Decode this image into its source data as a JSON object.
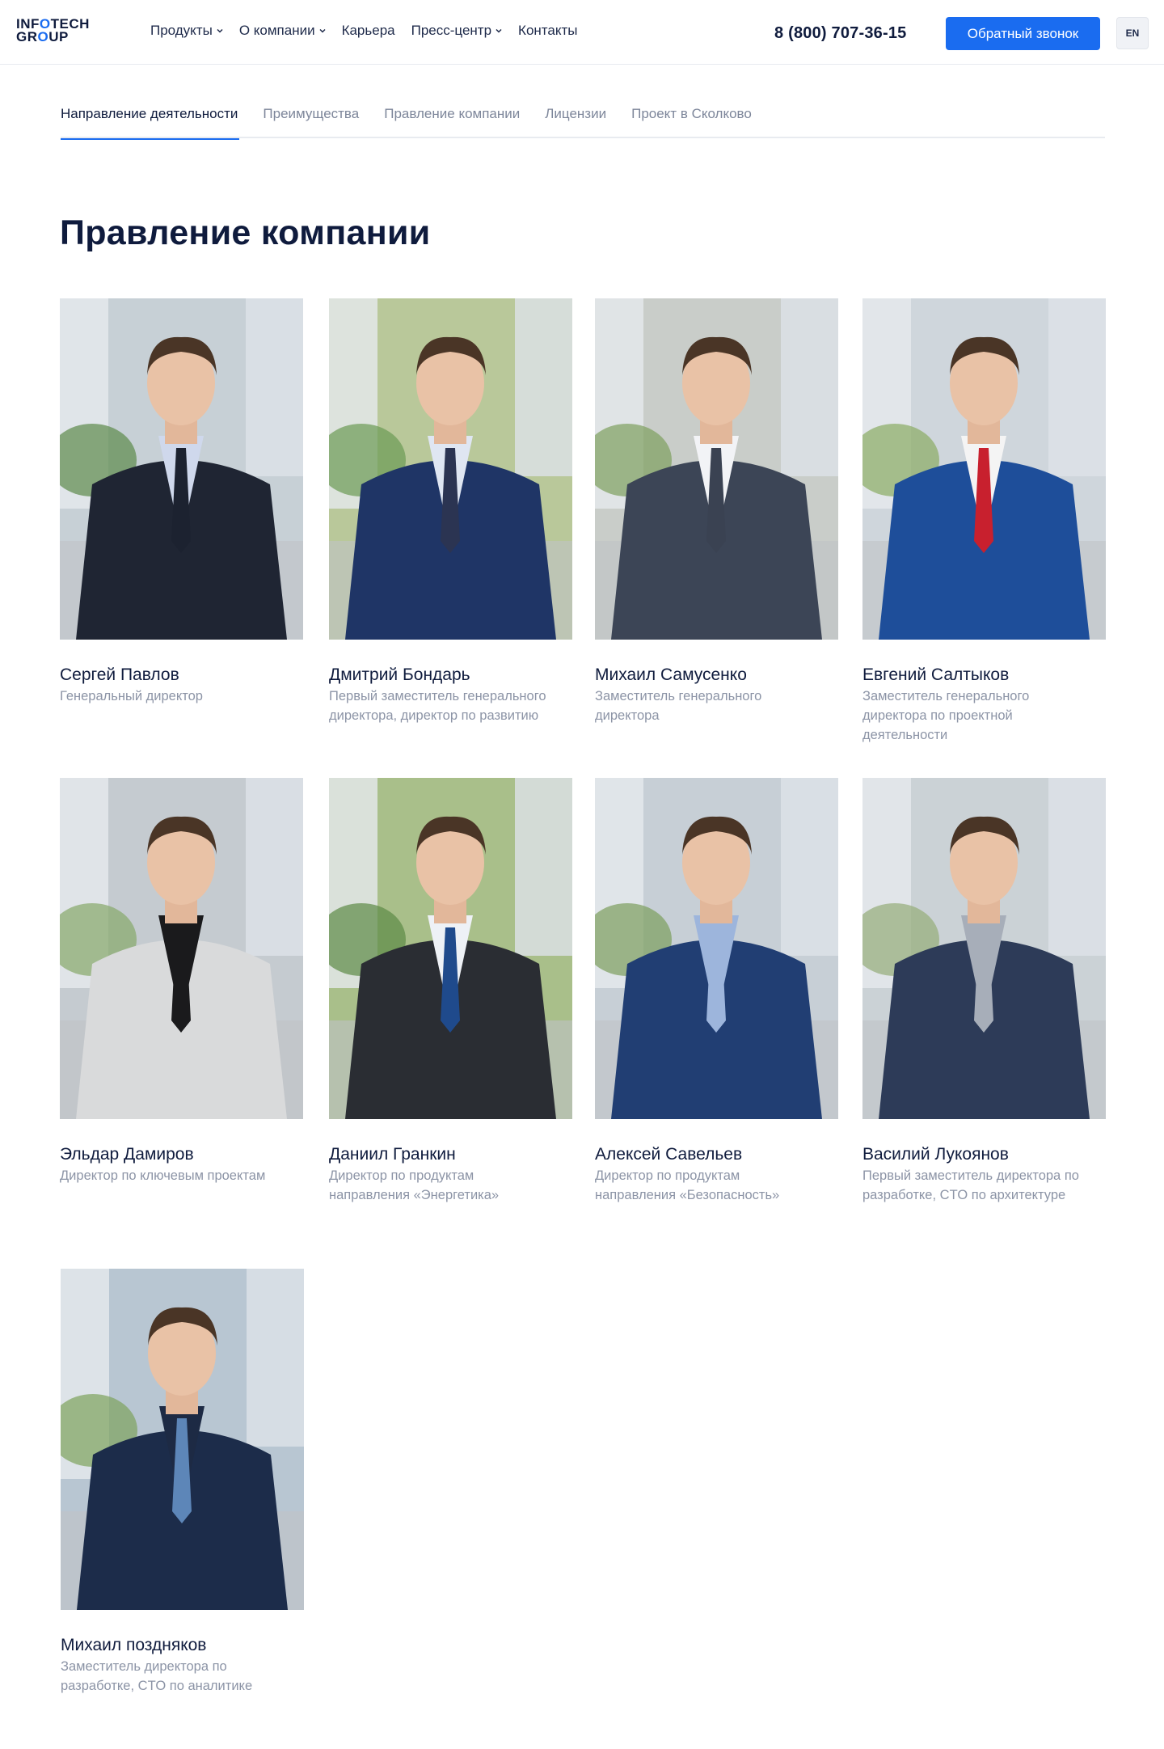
{
  "header": {
    "logo_top": "INFOTECH",
    "logo_bottom": "GROUP",
    "nav": [
      {
        "label": "Продукты",
        "has_dropdown": true
      },
      {
        "label": "О компании",
        "has_dropdown": true
      },
      {
        "label": "Карьера",
        "has_dropdown": false
      },
      {
        "label": "Пресс-центр",
        "has_dropdown": true
      },
      {
        "label": "Контакты",
        "has_dropdown": false
      }
    ],
    "phone": "8 (800) 707-36-15",
    "callback_label": "Обратный звонок",
    "lang_label": "EN"
  },
  "tabs": [
    {
      "label": "Направление деятельности",
      "active": true
    },
    {
      "label": "Преимущества",
      "active": false
    },
    {
      "label": "Правление компании",
      "active": false
    },
    {
      "label": "Лицензии",
      "active": false
    },
    {
      "label": "Проект в Сколково",
      "active": false
    }
  ],
  "title": "Правление компании",
  "people": [
    {
      "name": "Сергей Павлов",
      "role_lines": [
        "Генеральный директор"
      ],
      "jacket": "#1f2533",
      "shirt": "#cfd8ec",
      "tie": "#1c2230",
      "bg": "#c7d0d6",
      "green": "#5c8a4a"
    },
    {
      "name": "Дмитрий Бондарь",
      "role_lines": [
        "Первый заместитель генерального",
        "директора, директор по развитию"
      ],
      "jacket": "#1f3566",
      "shirt": "#dfe6f2",
      "tie": "#2b3452",
      "bg": "#b9c89a",
      "green": "#6b9a54"
    },
    {
      "name": "Михаил Самусенко",
      "role_lines": [
        "Заместитель генерального",
        "директора"
      ],
      "jacket": "#3c4556",
      "shirt": "#f2f3f6",
      "tie": "#3a4252",
      "bg": "#c9cdc9",
      "green": "#7da05e"
    },
    {
      "name": "Евгений Салтыков",
      "role_lines": [
        "Заместитель генерального",
        "директора по проектной",
        "деятельности"
      ],
      "jacket": "#1e4e9a",
      "shirt": "#f4f4f4",
      "tie": "#c8202e",
      "bg": "#cfd6dc",
      "green": "#8aab62"
    },
    {
      "name": "Эльдар Дамиров",
      "role_lines": [
        "Директор по ключевым проектам"
      ],
      "jacket": "#d9dadb",
      "shirt": "#1a1a1c",
      "tie": "#1a1a1c",
      "bg": "#c5cbd0",
      "green": "#86a86a"
    },
    {
      "name": "Даниил Гранкин",
      "role_lines": [
        "Директор по продуктам",
        "направления «Энергетика»"
      ],
      "jacket": "#2a2d33",
      "shirt": "#eef1f6",
      "tie": "#1f4a8c",
      "bg": "#a9bf8a",
      "green": "#5c8a46"
    },
    {
      "name": "Алексей Савельев",
      "role_lines": [
        "Директор по продуктам",
        "направления «Безопасность»"
      ],
      "jacket": "#213e73",
      "shirt": "#9db5dc",
      "tie": "#9db5dc",
      "bg": "#c7cfd6",
      "green": "#7c9e5c"
    },
    {
      "name": "Василий Лукоянов",
      "role_lines": [
        "Первый заместитель директора по",
        "разработке, CTO по архитектуре"
      ],
      "jacket": "#2d3b58",
      "shirt": "#a7aeb9",
      "tie": "#a7aeb9",
      "bg": "#cbd2d6",
      "green": "#94ad78"
    },
    {
      "name": "Михаил поздняков",
      "role_lines": [
        "Заместитель директора по",
        "разработке, CTO по аналитике"
      ],
      "jacket": "#1c2c4a",
      "shirt": "#1d2a44",
      "tie": "#5d86b8",
      "bg": "#b8c6d2",
      "green": "#7ea25c"
    }
  ]
}
